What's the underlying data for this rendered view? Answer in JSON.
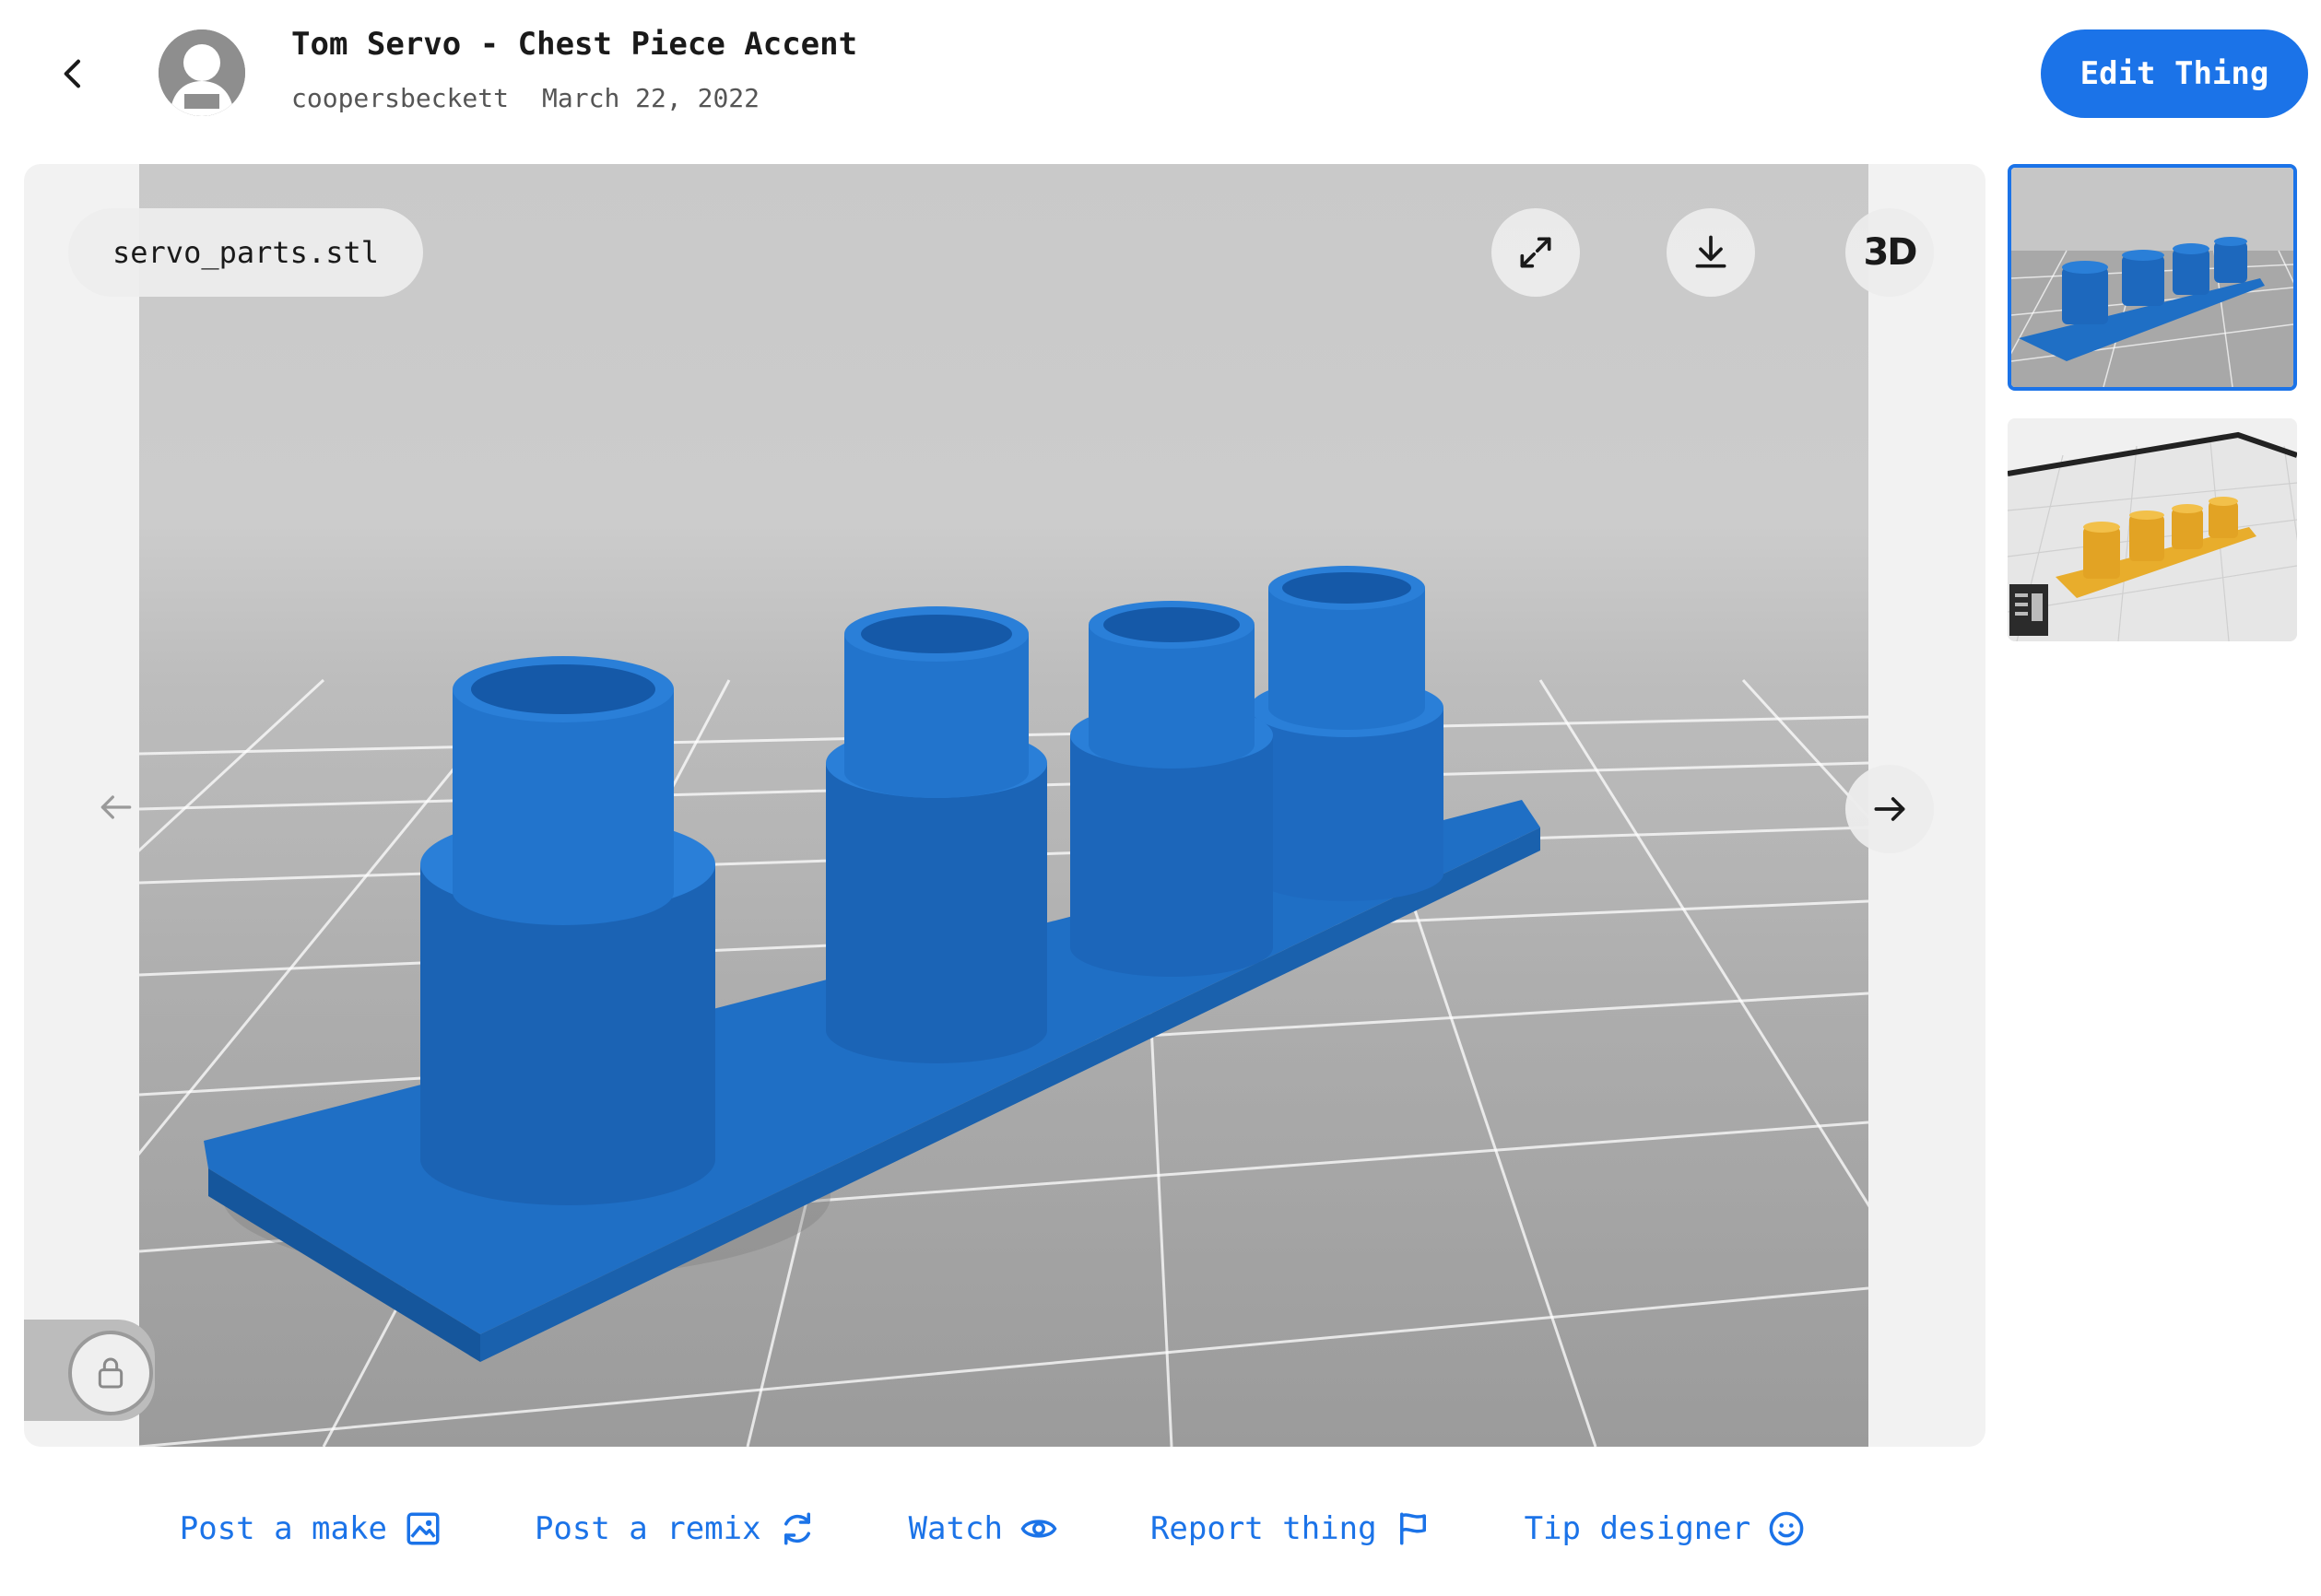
{
  "header": {
    "title": "Tom Servo - Chest Piece Accent",
    "author": "coopersbeckett",
    "date": "March 22, 2022",
    "edit_label": "Edit Thing"
  },
  "viewer": {
    "file_name": "servo_parts.stl",
    "view_mode_label": "3D",
    "icons": [
      "expand-icon",
      "download-icon",
      "view-3d-icon",
      "arrow-left-icon",
      "arrow-right-icon",
      "lock-icon"
    ]
  },
  "thumbnails": [
    {
      "name": "blue-render",
      "selected": true
    },
    {
      "name": "slicer-preview",
      "selected": false
    }
  ],
  "actions": [
    {
      "label": "Post a make",
      "icon": "image-icon"
    },
    {
      "label": "Post a remix",
      "icon": "remix-icon"
    },
    {
      "label": "Watch",
      "icon": "eye-icon"
    },
    {
      "label": "Report thing",
      "icon": "flag-icon"
    },
    {
      "label": "Tip designer",
      "icon": "smiley-icon"
    }
  ],
  "colors": {
    "accent": "#1b73e8",
    "model": "#1f6fc5",
    "model_alt": "#e8ad2c"
  }
}
